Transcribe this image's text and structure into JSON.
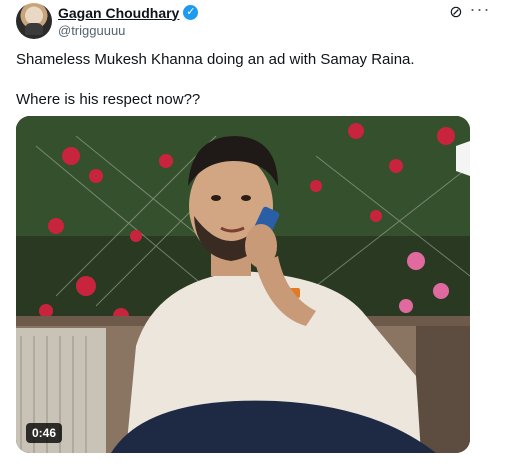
{
  "author": {
    "name": "Gagan Choudhary",
    "handle": "@trigguuuu",
    "verified": true
  },
  "icons": {
    "verified": "verified-badge-icon",
    "grok": "grok-icon",
    "more": "more-options-icon"
  },
  "tweet": {
    "text_line1": "Shameless Mukesh Khanna doing an ad with Samay Raina.",
    "text_line2": "Where is his respect now??"
  },
  "media": {
    "type": "video",
    "duration": "0:46"
  },
  "colors": {
    "accent": "#1d9bf0",
    "text": "#0f1419",
    "secondary": "#536471"
  }
}
